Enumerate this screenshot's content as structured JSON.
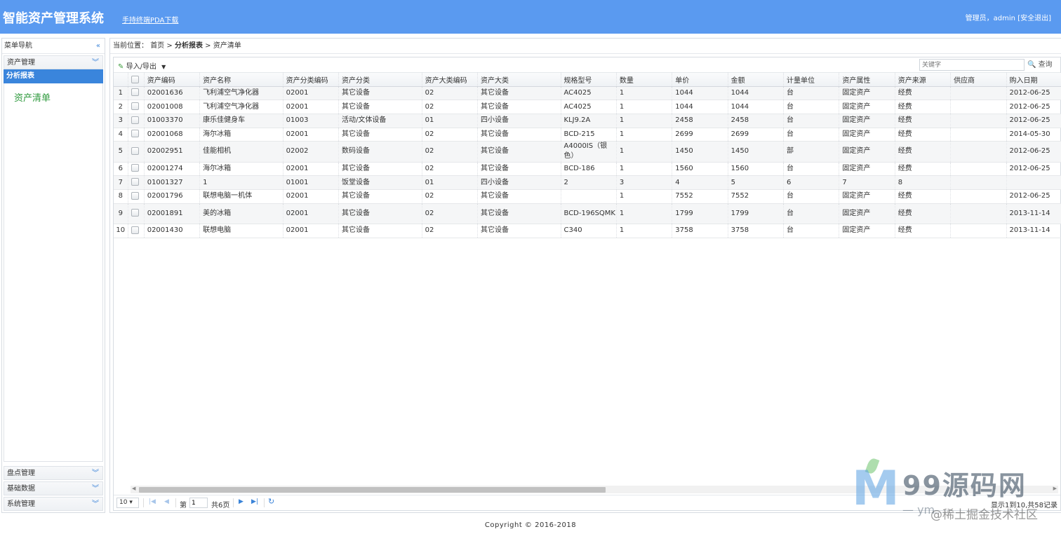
{
  "header": {
    "title": "智能资产管理系统",
    "pda_link": "手持终端PDA下载",
    "user_label": "管理员，admin",
    "logout": "[安全退出]"
  },
  "sidebar": {
    "title": "菜单导航",
    "collapse_icon": "«",
    "groups": [
      {
        "label": "资产管理"
      },
      {
        "label": "分析报表"
      },
      {
        "label": "盘点管理"
      },
      {
        "label": "基础数据"
      },
      {
        "label": "系统管理"
      }
    ],
    "active_item": "资产清单"
  },
  "breadcrumb": {
    "prefix": "当前位置：",
    "home": "首页",
    "sep": ">",
    "section": "分析报表",
    "page": "资产清单"
  },
  "toolbar": {
    "import_export": "导入/导出",
    "search_placeholder": "关键字",
    "search_button": "查询"
  },
  "table": {
    "columns": [
      "资产编码",
      "资产名称",
      "资产分类编码",
      "资产分类",
      "资产大类编码",
      "资产大类",
      "规格型号",
      "数量",
      "单价",
      "金额",
      "计量单位",
      "资产属性",
      "资产来源",
      "供应商",
      "购入日期"
    ],
    "rows": [
      {
        "n": "1",
        "cells": [
          "02001636",
          "飞利浦空气净化器",
          "02001",
          "其它设备",
          "02",
          "其它设备",
          "AC4025",
          "1",
          "1044",
          "1044",
          "台",
          "固定资产",
          "经费",
          "",
          "2012-06-25"
        ]
      },
      {
        "n": "2",
        "cells": [
          "02001008",
          "飞利浦空气净化器",
          "02001",
          "其它设备",
          "02",
          "其它设备",
          "AC4025",
          "1",
          "1044",
          "1044",
          "台",
          "固定资产",
          "经费",
          "",
          "2012-06-25"
        ]
      },
      {
        "n": "3",
        "cells": [
          "01003370",
          "康乐佳健身车",
          "01003",
          "活动/文体设备",
          "01",
          "四小设备",
          "KLJ9.2A",
          "1",
          "2458",
          "2458",
          "台",
          "固定资产",
          "经费",
          "",
          "2012-06-25"
        ]
      },
      {
        "n": "4",
        "cells": [
          "02001068",
          "海尔冰箱",
          "02001",
          "其它设备",
          "02",
          "其它设备",
          "BCD-215",
          "1",
          "2699",
          "2699",
          "台",
          "固定资产",
          "经费",
          "",
          "2014-05-30"
        ]
      },
      {
        "n": "5",
        "cells": [
          "02002951",
          "佳能相机",
          "02002",
          "数码设备",
          "02",
          "其它设备",
          "A4000IS（银色）",
          "1",
          "1450",
          "1450",
          "部",
          "固定资产",
          "经费",
          "",
          "2012-06-25"
        ]
      },
      {
        "n": "6",
        "cells": [
          "02001274",
          "海尔冰箱",
          "02001",
          "其它设备",
          "02",
          "其它设备",
          "BCD-186",
          "1",
          "1560",
          "1560",
          "台",
          "固定资产",
          "经费",
          "",
          "2012-06-25"
        ]
      },
      {
        "n": "7",
        "cells": [
          "01001327",
          "1",
          "01001",
          "饭堂设备",
          "01",
          "四小设备",
          "2",
          "3",
          "4",
          "5",
          "6",
          "7",
          "8",
          "",
          ""
        ]
      },
      {
        "n": "8",
        "cells": [
          "02001796",
          "联想电脑一机体",
          "02001",
          "其它设备",
          "02",
          "其它设备",
          "",
          "1",
          "7552",
          "7552",
          "台",
          "固定资产",
          "经费",
          "",
          "2012-06-25"
        ]
      },
      {
        "n": "9",
        "cells": [
          "02001891",
          "美的冰箱",
          "02001",
          "其它设备",
          "02",
          "其它设备",
          "BCD-196SQMK",
          "1",
          "1799",
          "1799",
          "台",
          "固定资产",
          "经费",
          "",
          "2013-11-14"
        ]
      },
      {
        "n": "10",
        "cells": [
          "02001430",
          "联想电脑",
          "02001",
          "其它设备",
          "02",
          "其它设备",
          "C340",
          "1",
          "3758",
          "3758",
          "台",
          "固定资产",
          "经费",
          "",
          "2013-11-14"
        ]
      }
    ]
  },
  "pager": {
    "page_size": "10 ▾",
    "page_prefix": "第",
    "page_value": "1",
    "page_suffix": "共6页",
    "info": "显示1到10,共58记录"
  },
  "footer": "Copyright © 2016-2018",
  "watermark": {
    "m": "M",
    "brand": "99源码网",
    "url": "— ym",
    "community": "@稀土掘金技术社区"
  },
  "colors": {
    "header": "#5a9af0",
    "active": "#3a85dc",
    "link_green": "#2f9a3e"
  }
}
